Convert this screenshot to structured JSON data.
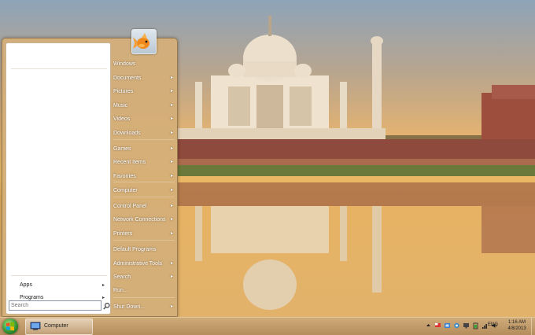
{
  "start_menu": {
    "left_items": [
      {
        "label": "Apps",
        "arrow": "▸"
      },
      {
        "label": "Programs",
        "arrow": "▸"
      }
    ],
    "search_placeholder": "Search",
    "right_items": [
      {
        "label": "Windows",
        "arrow": ""
      },
      {
        "label": "Documents",
        "arrow": "▸"
      },
      {
        "label": "Pictures",
        "arrow": "▸"
      },
      {
        "label": "Music",
        "arrow": "▸"
      },
      {
        "label": "Videos",
        "arrow": "▸"
      },
      {
        "label": "Downloads",
        "arrow": "▸"
      },
      {
        "label": "Games",
        "arrow": "▸"
      },
      {
        "label": "Recent Items",
        "arrow": "▸"
      },
      {
        "label": "Favorites",
        "arrow": "▸"
      },
      {
        "label": "Computer",
        "arrow": "▸"
      },
      {
        "label": "Control Panel",
        "arrow": "▸"
      },
      {
        "label": "Network Connections",
        "arrow": "▸"
      },
      {
        "label": "Printers",
        "arrow": "▸"
      },
      {
        "label": "Default Programs",
        "arrow": ""
      },
      {
        "label": "Administrative Tools",
        "arrow": "▸"
      },
      {
        "label": "Search",
        "arrow": "▸"
      },
      {
        "label": "Run...",
        "arrow": ""
      },
      {
        "label": "Shut Down...",
        "arrow": "▸"
      }
    ]
  },
  "taskbar": {
    "window_button": "Computer",
    "language": "ENG",
    "time": "1:16 AM",
    "date": "4/8/2013"
  },
  "colors": {
    "menu_background": "#d4ae78",
    "taskbar": "#c29c6a",
    "start_orb": "#2f8e2f"
  },
  "icons": [
    "windows-logo-icon",
    "goldfish-user-icon",
    "computer-icon",
    "search-icon",
    "flag-icon",
    "network-icon",
    "volume-icon",
    "battery-icon",
    "arrow-up-icon"
  ]
}
